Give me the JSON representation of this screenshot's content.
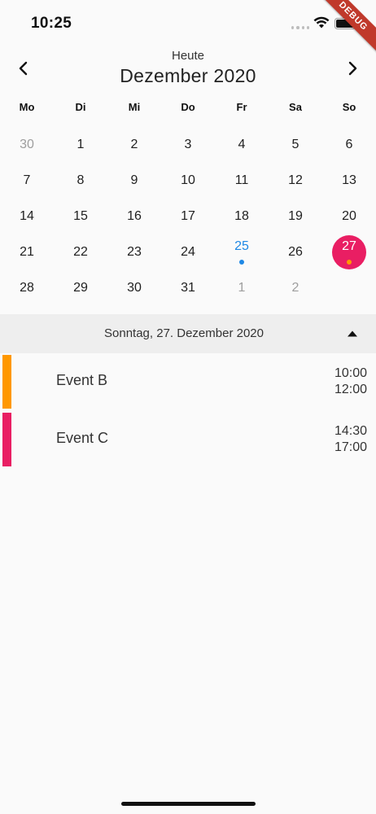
{
  "status_bar": {
    "time": "10:25"
  },
  "debug_banner": "DEBUG",
  "header": {
    "today_label": "Heute",
    "month_title": "Dezember 2020"
  },
  "weekdays": [
    "Mo",
    "Di",
    "Mi",
    "Do",
    "Fr",
    "Sa",
    "So"
  ],
  "weeks": [
    [
      "30",
      "1",
      "2",
      "3",
      "4",
      "5",
      "6"
    ],
    [
      "7",
      "8",
      "9",
      "10",
      "11",
      "12",
      "13"
    ],
    [
      "14",
      "15",
      "16",
      "17",
      "18",
      "19",
      "20"
    ],
    [
      "21",
      "22",
      "23",
      "24",
      "25",
      "26",
      "27"
    ],
    [
      "28",
      "29",
      "30",
      "31",
      "1",
      "2",
      ""
    ]
  ],
  "selected_date_label": "Sonntag, 27. Dezember 2020",
  "events": [
    {
      "title": "Event B",
      "start": "10:00",
      "end": "12:00",
      "color": "#ff9800"
    },
    {
      "title": "Event C",
      "start": "14:30",
      "end": "17:00",
      "color": "#e91e63"
    }
  ],
  "colors": {
    "accent": "#e91e63",
    "today": "#1e88e5",
    "event_dot": "#ff9800"
  }
}
